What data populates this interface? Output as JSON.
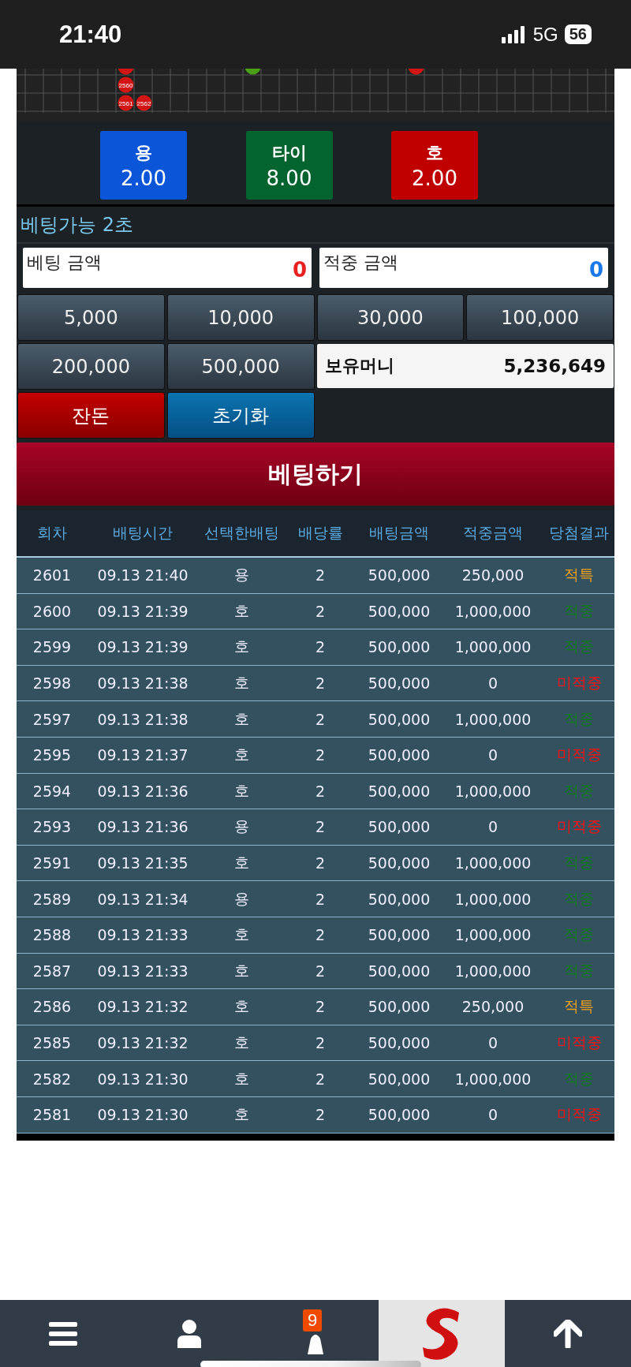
{
  "status_bar": {
    "time": "21:40",
    "network": "5G",
    "battery": "56"
  },
  "road": {
    "columns": [
      [
        {
          "kind": "empty"
        },
        {
          "kind": "empty"
        },
        {
          "kind": "empty"
        }
      ],
      [
        {
          "kind": "empty"
        },
        {
          "kind": "empty"
        },
        {
          "kind": "empty"
        }
      ],
      [
        {
          "kind": "empty"
        },
        {
          "kind": "empty"
        },
        {
          "kind": "empty"
        }
      ],
      [
        {
          "kind": "empty"
        },
        {
          "kind": "empty"
        },
        {
          "kind": "empty"
        }
      ],
      [
        {
          "kind": "empty"
        },
        {
          "kind": "empty"
        },
        {
          "kind": "empty"
        }
      ],
      [
        {
          "kind": "tiger"
        },
        {
          "kind": "tiger",
          "label": "2560"
        },
        {
          "kind": "tiger",
          "label": "2561"
        }
      ],
      [
        {
          "kind": "empty"
        },
        {
          "kind": "empty"
        },
        {
          "kind": "tiger",
          "label": "2562"
        }
      ],
      [
        {
          "kind": "empty"
        },
        {
          "kind": "empty"
        },
        {
          "kind": "empty"
        }
      ],
      [
        {
          "kind": "empty"
        },
        {
          "kind": "empty"
        },
        {
          "kind": "empty"
        }
      ],
      [
        {
          "kind": "empty"
        },
        {
          "kind": "empty"
        },
        {
          "kind": "empty"
        }
      ],
      [
        {
          "kind": "empty"
        },
        {
          "kind": "empty"
        },
        {
          "kind": "empty"
        }
      ],
      [
        {
          "kind": "empty"
        },
        {
          "kind": "empty"
        },
        {
          "kind": "empty"
        }
      ],
      [
        {
          "kind": "tie"
        },
        {
          "kind": "empty"
        },
        {
          "kind": "empty"
        }
      ],
      [
        {
          "kind": "empty"
        },
        {
          "kind": "empty"
        },
        {
          "kind": "empty"
        }
      ],
      [
        {
          "kind": "empty"
        },
        {
          "kind": "empty"
        },
        {
          "kind": "empty"
        }
      ],
      [
        {
          "kind": "empty"
        },
        {
          "kind": "empty"
        },
        {
          "kind": "empty"
        }
      ],
      [
        {
          "kind": "empty"
        },
        {
          "kind": "empty"
        },
        {
          "kind": "empty"
        }
      ],
      [
        {
          "kind": "empty"
        },
        {
          "kind": "empty"
        },
        {
          "kind": "empty"
        }
      ],
      [
        {
          "kind": "empty"
        },
        {
          "kind": "empty"
        },
        {
          "kind": "empty"
        }
      ],
      [
        {
          "kind": "empty"
        },
        {
          "kind": "empty"
        },
        {
          "kind": "empty"
        }
      ],
      [
        {
          "kind": "empty"
        },
        {
          "kind": "empty"
        },
        {
          "kind": "empty"
        }
      ],
      [
        {
          "kind": "tiger"
        },
        {
          "kind": "empty"
        },
        {
          "kind": "empty"
        }
      ]
    ]
  },
  "bet_options": [
    {
      "label": "용",
      "odds": "2.00",
      "color": "#0a55d8"
    },
    {
      "label": "타이",
      "odds": "8.00",
      "color": "#046430"
    },
    {
      "label": "호",
      "odds": "2.00",
      "color": "#c00000"
    }
  ],
  "timer": "베팅가능 2초",
  "bet_amount": {
    "label": "베팅 금액",
    "value": "0"
  },
  "win_amount": {
    "label": "적중 금액",
    "value": "0"
  },
  "chips": [
    "5,000",
    "10,000",
    "30,000",
    "100,000",
    "200,000",
    "500,000"
  ],
  "balance": {
    "label": "보유머니",
    "value": "5,236,649"
  },
  "actions": [
    {
      "label": "잔돈",
      "kind": "change"
    },
    {
      "label": "초기화",
      "kind": "reset"
    }
  ],
  "submit": "베팅하기",
  "history": {
    "columns": [
      "회차",
      "배팅시간",
      "선택한배팅",
      "배당률",
      "배팅금액",
      "적중금액",
      "당첨결과"
    ],
    "rows": [
      {
        "cells": [
          "2601",
          "09.13 21:40",
          "용",
          "2",
          "500,000",
          "250,000",
          "적특"
        ],
        "kind": "special"
      },
      {
        "cells": [
          "2600",
          "09.13 21:39",
          "호",
          "2",
          "500,000",
          "1,000,000",
          "적중"
        ],
        "kind": "win"
      },
      {
        "cells": [
          "2599",
          "09.13 21:39",
          "호",
          "2",
          "500,000",
          "1,000,000",
          "적중"
        ],
        "kind": "win"
      },
      {
        "cells": [
          "2598",
          "09.13 21:38",
          "호",
          "2",
          "500,000",
          "0",
          "미적중"
        ],
        "kind": "lose"
      },
      {
        "cells": [
          "2597",
          "09.13 21:38",
          "호",
          "2",
          "500,000",
          "1,000,000",
          "적중"
        ],
        "kind": "win"
      },
      {
        "cells": [
          "2595",
          "09.13 21:37",
          "호",
          "2",
          "500,000",
          "0",
          "미적중"
        ],
        "kind": "lose"
      },
      {
        "cells": [
          "2594",
          "09.13 21:36",
          "호",
          "2",
          "500,000",
          "1,000,000",
          "적중"
        ],
        "kind": "win"
      },
      {
        "cells": [
          "2593",
          "09.13 21:36",
          "용",
          "2",
          "500,000",
          "0",
          "미적중"
        ],
        "kind": "lose"
      },
      {
        "cells": [
          "2591",
          "09.13 21:35",
          "호",
          "2",
          "500,000",
          "1,000,000",
          "적중"
        ],
        "kind": "win"
      },
      {
        "cells": [
          "2589",
          "09.13 21:34",
          "용",
          "2",
          "500,000",
          "1,000,000",
          "적중"
        ],
        "kind": "win"
      },
      {
        "cells": [
          "2588",
          "09.13 21:33",
          "호",
          "2",
          "500,000",
          "1,000,000",
          "적중"
        ],
        "kind": "win"
      },
      {
        "cells": [
          "2587",
          "09.13 21:33",
          "호",
          "2",
          "500,000",
          "1,000,000",
          "적중"
        ],
        "kind": "win"
      },
      {
        "cells": [
          "2586",
          "09.13 21:32",
          "호",
          "2",
          "500,000",
          "250,000",
          "적특"
        ],
        "kind": "special"
      },
      {
        "cells": [
          "2585",
          "09.13 21:32",
          "호",
          "2",
          "500,000",
          "0",
          "미적중"
        ],
        "kind": "lose"
      },
      {
        "cells": [
          "2582",
          "09.13 21:30",
          "호",
          "2",
          "500,000",
          "1,000,000",
          "적중"
        ],
        "kind": "win"
      },
      {
        "cells": [
          "2581",
          "09.13 21:30",
          "호",
          "2",
          "500,000",
          "0",
          "미적중"
        ],
        "kind": "lose"
      }
    ]
  },
  "bottom_nav": {
    "badge": "9"
  }
}
